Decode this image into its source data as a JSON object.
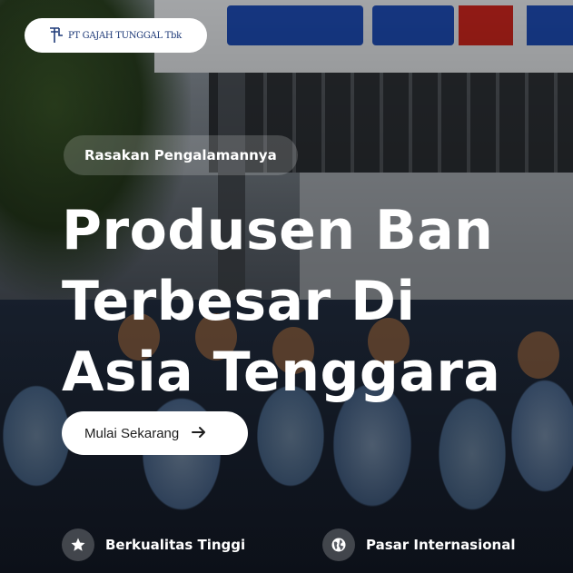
{
  "brand": {
    "logo_text": "PT GAJAH TUNGGAL Tbk",
    "logo_icon": "gajah-tunggal-logo-icon",
    "text_color": "#1e3a78"
  },
  "hero": {
    "eyebrow": "Rasakan Pengalamannya",
    "headline_lines": [
      "Produsen Ban",
      "Terbesar Di",
      "Asia Tenggara"
    ],
    "cta_label": "Mulai Sekarang",
    "cta_icon": "arrow-right-icon"
  },
  "features": [
    {
      "label": "Berkualitas Tinggi",
      "icon": "star-icon"
    },
    {
      "label": "Pasar Internasional",
      "icon": "globe-icon"
    }
  ],
  "colors": {
    "text_on_dark": "#ffffff",
    "pill_background": "#ffffff",
    "sign_blue": "#1e4db7",
    "sign_red": "#d0261e"
  }
}
